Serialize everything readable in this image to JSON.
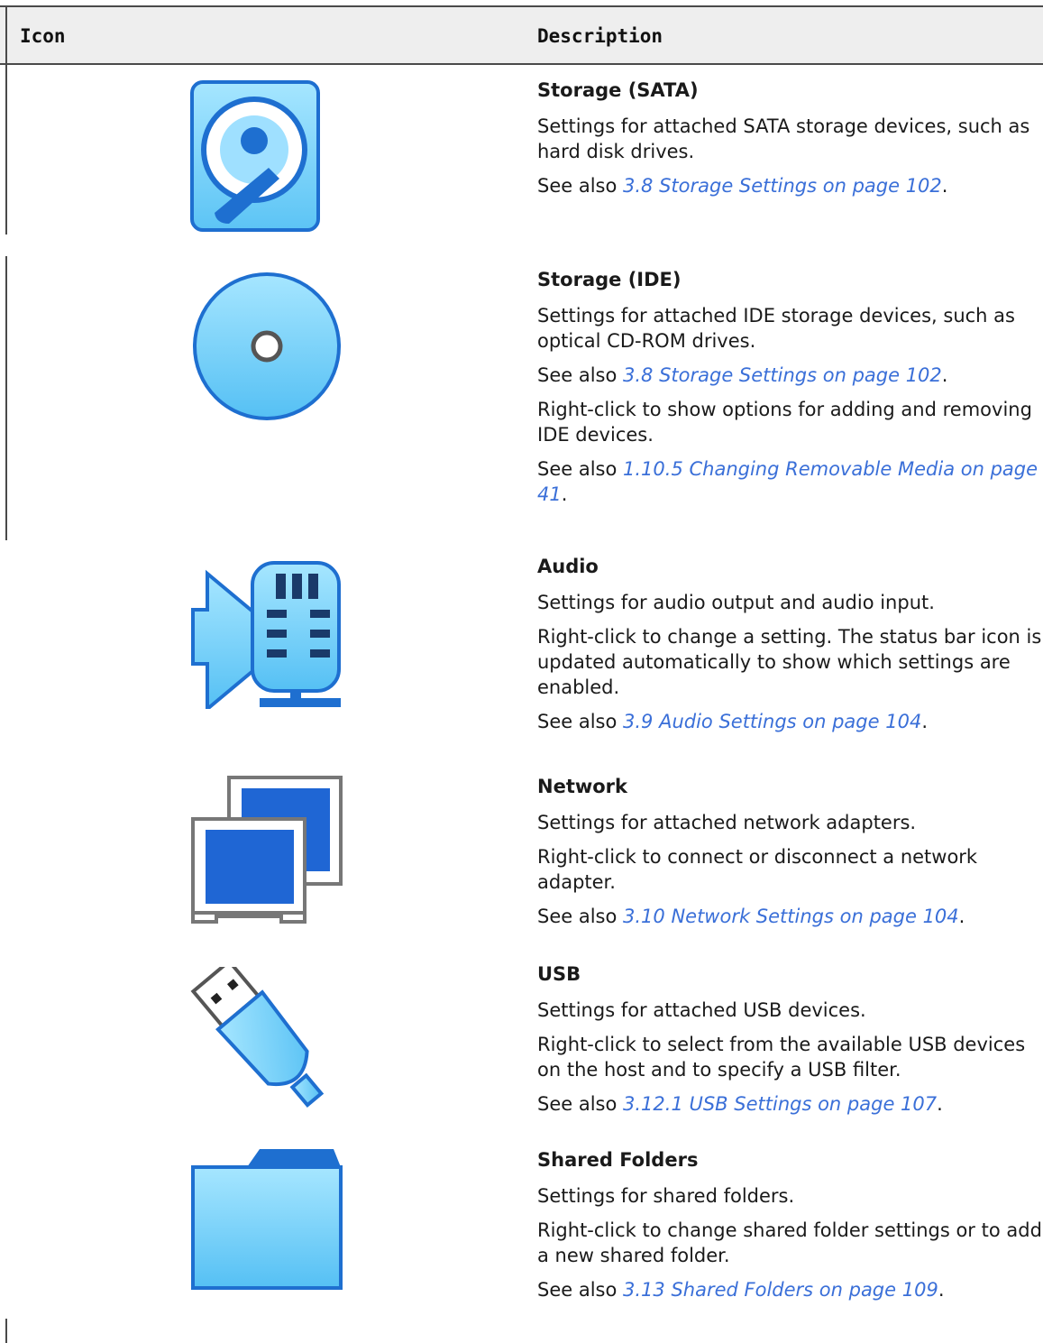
{
  "header": {
    "col_icon": "Icon",
    "col_description": "Description"
  },
  "rows": [
    {
      "icon": "storage-sata-icon",
      "title": "Storage (SATA)",
      "paragraphs": [
        "Settings for attached SATA storage devices, such as hard disk drives."
      ],
      "see_also": [
        {
          "prefix": "See also ",
          "link": "3.8 Storage Settings on page 102",
          "suffix": "."
        }
      ]
    },
    {
      "icon": "storage-ide-icon",
      "title": "Storage (IDE)",
      "paragraphs": [
        "Settings for attached IDE storage devices, such as optical CD-ROM drives."
      ],
      "see_also": [
        {
          "prefix": "See also ",
          "link": "3.8 Storage Settings on page 102",
          "suffix": "."
        }
      ],
      "paragraphs2": [
        "Right-click to show options for adding and removing IDE devices."
      ],
      "see_also2": [
        {
          "prefix": "See also ",
          "link": "1.10.5 Changing Removable Media on page 41",
          "suffix": "."
        }
      ]
    },
    {
      "icon": "audio-icon",
      "title": "Audio",
      "paragraphs": [
        "Settings for audio output and audio input.",
        "Right-click to change a setting. The status bar icon is updated automatically to show which settings are enabled."
      ],
      "see_also": [
        {
          "prefix": "See also ",
          "link": "3.9 Audio Settings on page 104",
          "suffix": "."
        }
      ]
    },
    {
      "icon": "network-icon",
      "title": "Network",
      "paragraphs": [
        "Settings for attached network adapters.",
        "Right-click to connect or disconnect a network adapter."
      ],
      "see_also": [
        {
          "prefix": "See also ",
          "link": "3.10 Network Settings on page 104",
          "suffix": "."
        }
      ]
    },
    {
      "icon": "usb-icon",
      "title": "USB",
      "paragraphs": [
        "Settings for attached USB devices.",
        "Right-click to select from the available USB devices on the host and to specify a USB filter."
      ],
      "see_also": [
        {
          "prefix": "See also ",
          "link": "3.12.1 USB Settings on page 107",
          "suffix": "."
        }
      ]
    },
    {
      "icon": "shared-folder-icon",
      "title": "Shared Folders",
      "paragraphs": [
        "Settings for shared folders.",
        "Right-click to change shared folder settings or to add a new shared folder."
      ],
      "see_also": [
        {
          "prefix": "See also ",
          "link": "3.13 Shared Folders on page 109",
          "suffix": "."
        }
      ]
    }
  ],
  "colors": {
    "link": "#3a6fd8",
    "icon_blue": "#2f7fe0",
    "icon_light": "#8fd6ff",
    "header_bg": "#eeeeee"
  }
}
